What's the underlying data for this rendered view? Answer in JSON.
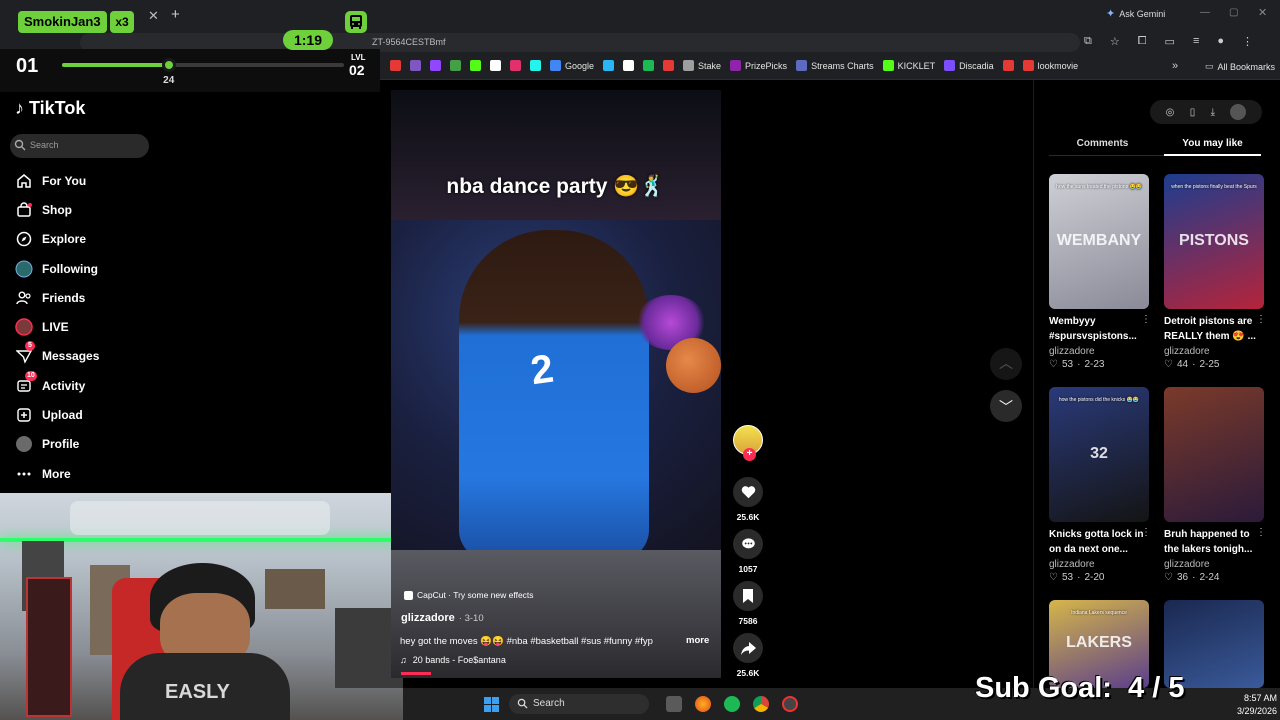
{
  "browser": {
    "ask_gemini": "Ask Gemini",
    "url": "ZT-9564CESTBmf",
    "bookmarks": [
      {
        "label": "",
        "color": "#e53935"
      },
      {
        "label": "",
        "color": "#7e57c2"
      },
      {
        "label": "",
        "color": "#9146ff"
      },
      {
        "label": "",
        "color": "#43a047"
      },
      {
        "label": "",
        "color": "#53fc18"
      },
      {
        "label": "",
        "color": "#ffffff"
      },
      {
        "label": "",
        "color": "#e1306c"
      },
      {
        "label": "",
        "color": "#25f4ee"
      },
      {
        "label": "Google",
        "color": "#4285f4"
      },
      {
        "label": "",
        "color": "#29b6f6"
      },
      {
        "label": "",
        "color": "#ffffff"
      },
      {
        "label": "",
        "color": "#1db954"
      },
      {
        "label": "",
        "color": "#e53935"
      },
      {
        "label": "Stake",
        "color": "#9e9e9e"
      },
      {
        "label": "PrizePicks",
        "color": "#8e24aa"
      },
      {
        "label": "Streams Charts",
        "color": "#5c6bc0"
      },
      {
        "label": "KICKLET",
        "color": "#53fc18"
      },
      {
        "label": "Discadia",
        "color": "#7c4dff"
      },
      {
        "label": "",
        "color": "#e53935"
      },
      {
        "label": "lookmovie",
        "color": "#e53935"
      }
    ],
    "all_bookmarks": "All Bookmarks"
  },
  "overlay": {
    "name": "SmokinJan3",
    "multiplier": "x3",
    "timer": "1:19",
    "count": "01",
    "level_value": "24",
    "level_label": "LVL",
    "level_num": "02",
    "level_progress": 0.38,
    "sub_goal": "Sub Goal:  4 / 5"
  },
  "tiktok": {
    "logo": "TikTok",
    "search_placeholder": "Search",
    "nav": [
      {
        "label": "For You",
        "icon": "home-icon"
      },
      {
        "label": "Shop",
        "icon": "shop-icon"
      },
      {
        "label": "Explore",
        "icon": "compass-icon"
      },
      {
        "label": "Following",
        "icon": "following-avatar-icon"
      },
      {
        "label": "Friends",
        "icon": "friends-icon"
      },
      {
        "label": "LIVE",
        "icon": "live-icon"
      },
      {
        "label": "Messages",
        "icon": "messages-icon",
        "badge": "5"
      },
      {
        "label": "Activity",
        "icon": "activity-icon",
        "badge": "10"
      },
      {
        "label": "Upload",
        "icon": "upload-icon"
      },
      {
        "label": "Profile",
        "icon": "profile-icon"
      },
      {
        "label": "More",
        "icon": "more-icon"
      }
    ],
    "video": {
      "caption_overlay": "nba dance party 😎🕺",
      "jersey_number": "2",
      "effect": "CapCut · Try some new effects",
      "author": "glizzadore",
      "date": "· 3-10",
      "description": "hey got the moves 😝😝 #nba #basketball #sus #funny #fyp",
      "more": "more",
      "music": "20 bands - Foe$antana"
    },
    "actions": {
      "likes": "25.6K",
      "comments": "1057",
      "saves": "7586",
      "shares": "25.6K"
    },
    "tabs": {
      "comments": "Comments",
      "you_may_like": "You may like"
    },
    "cards": [
      {
        "title": "Wembyyy #spursvspistons...",
        "author": "glizzadore",
        "likes": "53",
        "date": "2-23",
        "caption": "how the suns treated the pistons 😭😭",
        "thumb_text": "WEMBANY",
        "colors": [
          "#cfcfd6",
          "#8a8a98"
        ]
      },
      {
        "title": "Detroit pistons are REALLY them 😍 ...",
        "author": "glizzadore",
        "likes": "44",
        "date": "2-25",
        "caption": "when the pistons finally beat the Spurs",
        "thumb_text": "PISTONS",
        "colors": [
          "#1d3d8f",
          "#b5243a"
        ]
      },
      {
        "title": "Knicks gotta lock in on da next one...",
        "author": "glizzadore",
        "likes": "53",
        "date": "2-20",
        "caption": "how the pistons did the knicks 😭😭",
        "thumb_text": "32",
        "colors": [
          "#2a3a7a",
          "#141414"
        ]
      },
      {
        "title": "Bruh happened to the lakers tonigh...",
        "author": "glizzadore",
        "likes": "36",
        "date": "2-24",
        "caption": "",
        "thumb_text": "",
        "colors": [
          "#7a3a2a",
          "#2b1a3a"
        ]
      },
      {
        "title": "",
        "author": "",
        "likes": "",
        "date": "",
        "caption": "Indiana Lakers sequence",
        "thumb_text": "LAKERS",
        "colors": [
          "#d6b64a",
          "#5a3e8a"
        ]
      },
      {
        "title": "",
        "author": "",
        "likes": "",
        "date": "",
        "caption": "",
        "thumb_text": "",
        "colors": [
          "#1a2850",
          "#3a5a9a"
        ]
      }
    ]
  },
  "taskbar": {
    "search": "Search",
    "time": "8:57 AM",
    "date": "3/29/2026"
  }
}
